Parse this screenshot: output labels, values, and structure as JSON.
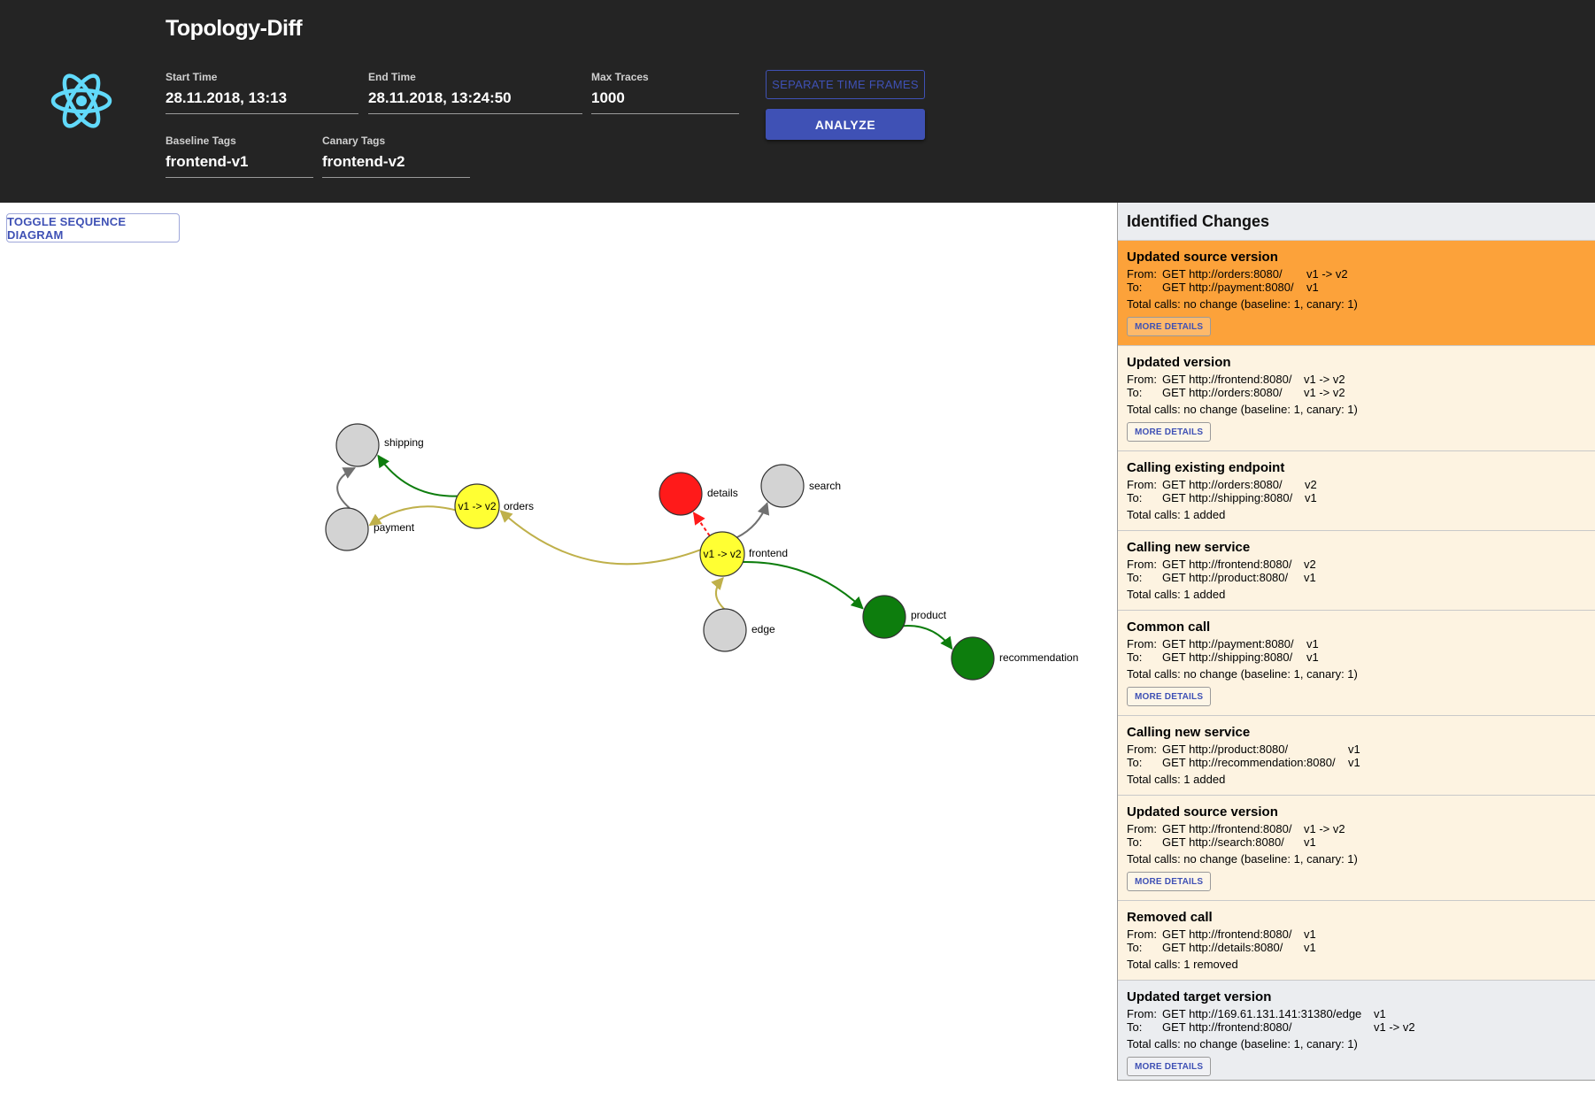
{
  "app": {
    "title": "Topology-Diff"
  },
  "colors": {
    "header_bg": "#242424",
    "accent": "#3f51b5",
    "selected": "#fca23a",
    "card_bg": "#fdf3e1",
    "logo": "#61dafb"
  },
  "filters": {
    "start_time": {
      "label": "Start Time",
      "value": "28.11.2018, 13:13"
    },
    "end_time": {
      "label": "End Time",
      "value": "28.11.2018, 13:24:50"
    },
    "max_traces": {
      "label": "Max Traces",
      "value": "1000"
    },
    "baseline_tags": {
      "label": "Baseline Tags",
      "value": "frontend-v1"
    },
    "canary_tags": {
      "label": "Canary Tags",
      "value": "frontend-v2"
    }
  },
  "buttons": {
    "separate": "SEPARATE TIME FRAMES",
    "analyze": "ANALYZE",
    "toggle_sequence": "TOGGLE SEQUENCE DIAGRAM"
  },
  "graph": {
    "nodes": [
      {
        "id": "shipping",
        "label": "shipping",
        "inner": "",
        "color": "#d3d3d3"
      },
      {
        "id": "payment",
        "label": "payment",
        "inner": "",
        "color": "#d3d3d3"
      },
      {
        "id": "orders",
        "label": "orders",
        "inner": "v1 -> v2",
        "color": "#ffff33"
      },
      {
        "id": "details",
        "label": "details",
        "inner": "",
        "color": "#ff1a1a"
      },
      {
        "id": "search",
        "label": "search",
        "inner": "",
        "color": "#d3d3d3"
      },
      {
        "id": "frontend",
        "label": "frontend",
        "inner": "v1 -> v2",
        "color": "#ffff33"
      },
      {
        "id": "edge",
        "label": "edge",
        "inner": "",
        "color": "#d3d3d3"
      },
      {
        "id": "product",
        "label": "product",
        "inner": "",
        "color": "#0d7d0d"
      },
      {
        "id": "recommendation",
        "label": "recommendation",
        "inner": "",
        "color": "#0d7d0d"
      }
    ],
    "edges": [
      {
        "from": "orders",
        "to": "shipping",
        "color": "#0d7d0d"
      },
      {
        "from": "orders",
        "to": "payment",
        "color": "#bfb04a"
      },
      {
        "from": "payment",
        "to": "shipping",
        "color": "#707070"
      },
      {
        "from": "frontend",
        "to": "orders",
        "color": "#bfb04a"
      },
      {
        "from": "frontend",
        "to": "details",
        "color": "#ff1a1a",
        "dashed": true
      },
      {
        "from": "frontend",
        "to": "search",
        "color": "#707070"
      },
      {
        "from": "edge",
        "to": "frontend",
        "color": "#bfb04a"
      },
      {
        "from": "frontend",
        "to": "product",
        "color": "#0d7d0d"
      },
      {
        "from": "product",
        "to": "recommendation",
        "color": "#0d7d0d"
      }
    ]
  },
  "changes_panel": {
    "title": "Identified Changes",
    "from_label": "From:",
    "to_label": "To:",
    "details_label": "MORE DETAILS",
    "items": [
      {
        "title": "Updated source version",
        "from": "GET http://orders:8080/",
        "from_ver": "v1 -> v2",
        "to": "GET http://payment:8080/",
        "to_ver": "v1",
        "total": "Total calls: no change (baseline: 1, canary: 1)",
        "details": true,
        "selected": true
      },
      {
        "title": "Updated version",
        "from": "GET http://frontend:8080/",
        "from_ver": "v1 -> v2",
        "to": "GET http://orders:8080/",
        "to_ver": "v1 -> v2",
        "total": "Total calls: no change (baseline: 1, canary: 1)",
        "details": true
      },
      {
        "title": "Calling existing endpoint",
        "from": "GET http://orders:8080/",
        "from_ver": "v2",
        "to": "GET http://shipping:8080/",
        "to_ver": "v1",
        "total": "Total calls: 1 added",
        "details": false
      },
      {
        "title": "Calling new service",
        "from": "GET http://frontend:8080/",
        "from_ver": "v2",
        "to": "GET http://product:8080/",
        "to_ver": "v1",
        "total": "Total calls: 1 added",
        "details": false
      },
      {
        "title": "Common call",
        "from": "GET http://payment:8080/",
        "from_ver": "v1",
        "to": "GET http://shipping:8080/",
        "to_ver": "v1",
        "total": "Total calls: no change (baseline: 1, canary: 1)",
        "details": true
      },
      {
        "title": "Calling new service",
        "from": "GET http://product:8080/",
        "from_ver": "v1",
        "to": "GET http://recommendation:8080/",
        "to_ver": "v1",
        "total": "Total calls: 1 added",
        "details": false
      },
      {
        "title": "Updated source version",
        "from": "GET http://frontend:8080/",
        "from_ver": "v1 -> v2",
        "to": "GET http://search:8080/",
        "to_ver": "v1",
        "total": "Total calls: no change (baseline: 1, canary: 1)",
        "details": true
      },
      {
        "title": "Removed call",
        "from": "GET http://frontend:8080/",
        "from_ver": "v1",
        "to": "GET http://details:8080/",
        "to_ver": "v1",
        "total": "Total calls: 1 removed",
        "details": false
      },
      {
        "title": "Updated target version",
        "from": "GET http://169.61.131.141:31380/edge",
        "from_ver": "v1",
        "to": "GET http://frontend:8080/",
        "to_ver": "v1 -> v2",
        "total": "Total calls: no change (baseline: 1, canary: 1)",
        "details": true,
        "last": true
      }
    ]
  }
}
